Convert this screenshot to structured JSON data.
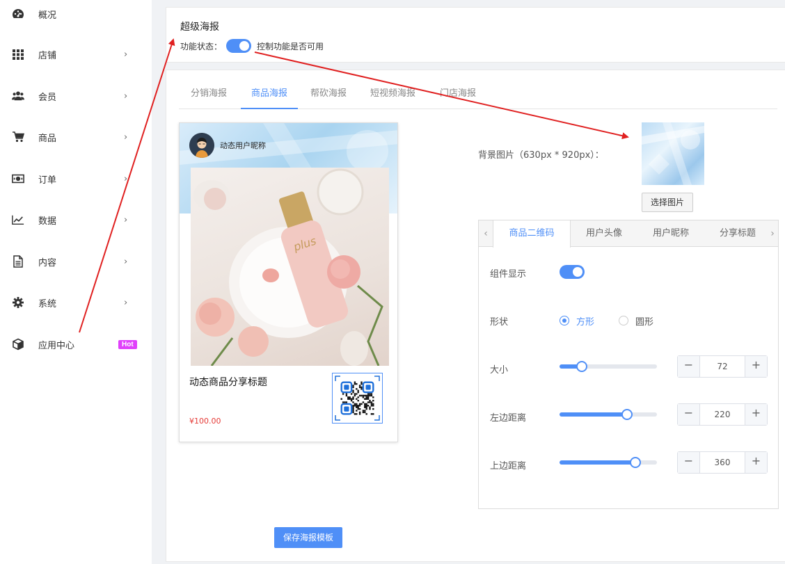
{
  "sidebar": {
    "items": [
      {
        "label": "概况",
        "icon": "dashboard-icon",
        "has_chevron": false
      },
      {
        "label": "店铺",
        "icon": "grid-icon",
        "has_chevron": true
      },
      {
        "label": "会员",
        "icon": "users-icon",
        "has_chevron": true
      },
      {
        "label": "商品",
        "icon": "cart-icon",
        "has_chevron": true
      },
      {
        "label": "订单",
        "icon": "money-icon",
        "has_chevron": true
      },
      {
        "label": "数据",
        "icon": "chart-line-icon",
        "has_chevron": true
      },
      {
        "label": "内容",
        "icon": "document-icon",
        "has_chevron": true
      },
      {
        "label": "系统",
        "icon": "gear-icon",
        "has_chevron": true
      },
      {
        "label": "应用中心",
        "icon": "box-icon",
        "has_chevron": false,
        "badge": "Hot"
      }
    ],
    "chevron": "›"
  },
  "header": {
    "title": "超级海报",
    "status_label": "功能状态：",
    "status_on": true,
    "status_desc": "控制功能是否可用"
  },
  "tabs": [
    {
      "label": "分销海报",
      "active": false
    },
    {
      "label": "商品海报",
      "active": true
    },
    {
      "label": "帮砍海报",
      "active": false
    },
    {
      "label": "短视频海报",
      "active": false
    },
    {
      "label": "门店海报",
      "active": false
    }
  ],
  "poster": {
    "nickname": "动态用户昵称",
    "goods_title": "动态商品分享标题",
    "price": "¥100.00",
    "product_brand": "plus"
  },
  "background": {
    "label": "背景图片（630px * 920px）：",
    "pick_button": "选择图片"
  },
  "component_panel": {
    "tabs": [
      {
        "label": "商品二维码",
        "active": true
      },
      {
        "label": "用户头像",
        "active": false
      },
      {
        "label": "用户昵称",
        "active": false
      },
      {
        "label": "分享标题",
        "active": false
      }
    ],
    "arrow_left": "‹",
    "arrow_right": "›",
    "display_label": "组件显示",
    "display_on": true,
    "shape_label": "形状",
    "shape_options": [
      {
        "label": "方形",
        "checked": true
      },
      {
        "label": "圆形",
        "checked": false
      }
    ],
    "size": {
      "label": "大小",
      "value": "72",
      "level": 0.23
    },
    "left": {
      "label": "左边距离",
      "value": "220",
      "level": 0.69
    },
    "top": {
      "label": "上边距离",
      "value": "360",
      "level": 0.78
    },
    "minus": "−",
    "plus": "+"
  },
  "save_button": "保存海报模板",
  "colors": {
    "accent": "#4f8ff7",
    "price": "#e53935",
    "hot_badge": "#e040fb",
    "annotation_arrow": "#e02020"
  }
}
